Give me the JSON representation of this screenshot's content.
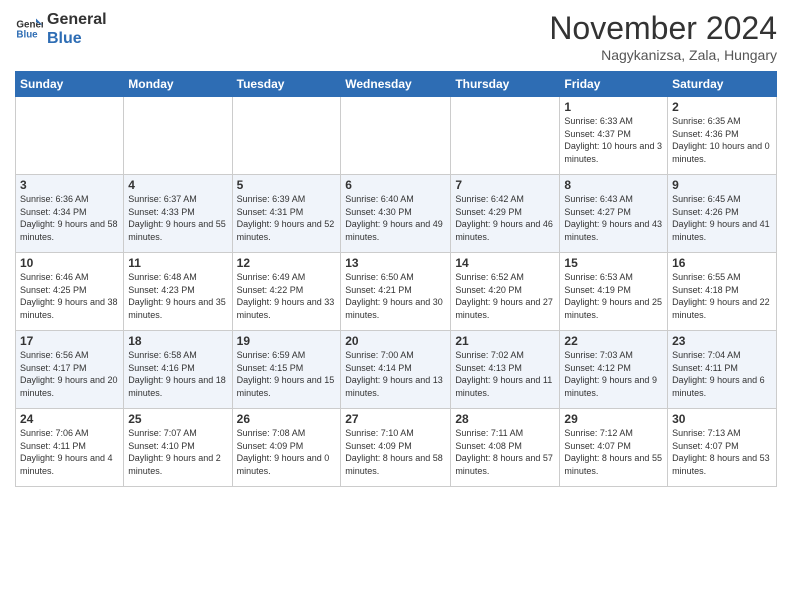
{
  "logo": {
    "line1": "General",
    "line2": "Blue"
  },
  "title": "November 2024",
  "location": "Nagykanizsa, Zala, Hungary",
  "headers": [
    "Sunday",
    "Monday",
    "Tuesday",
    "Wednesday",
    "Thursday",
    "Friday",
    "Saturday"
  ],
  "weeks": [
    [
      {
        "day": "",
        "info": ""
      },
      {
        "day": "",
        "info": ""
      },
      {
        "day": "",
        "info": ""
      },
      {
        "day": "",
        "info": ""
      },
      {
        "day": "",
        "info": ""
      },
      {
        "day": "1",
        "info": "Sunrise: 6:33 AM\nSunset: 4:37 PM\nDaylight: 10 hours and 3 minutes."
      },
      {
        "day": "2",
        "info": "Sunrise: 6:35 AM\nSunset: 4:36 PM\nDaylight: 10 hours and 0 minutes."
      }
    ],
    [
      {
        "day": "3",
        "info": "Sunrise: 6:36 AM\nSunset: 4:34 PM\nDaylight: 9 hours and 58 minutes."
      },
      {
        "day": "4",
        "info": "Sunrise: 6:37 AM\nSunset: 4:33 PM\nDaylight: 9 hours and 55 minutes."
      },
      {
        "day": "5",
        "info": "Sunrise: 6:39 AM\nSunset: 4:31 PM\nDaylight: 9 hours and 52 minutes."
      },
      {
        "day": "6",
        "info": "Sunrise: 6:40 AM\nSunset: 4:30 PM\nDaylight: 9 hours and 49 minutes."
      },
      {
        "day": "7",
        "info": "Sunrise: 6:42 AM\nSunset: 4:29 PM\nDaylight: 9 hours and 46 minutes."
      },
      {
        "day": "8",
        "info": "Sunrise: 6:43 AM\nSunset: 4:27 PM\nDaylight: 9 hours and 43 minutes."
      },
      {
        "day": "9",
        "info": "Sunrise: 6:45 AM\nSunset: 4:26 PM\nDaylight: 9 hours and 41 minutes."
      }
    ],
    [
      {
        "day": "10",
        "info": "Sunrise: 6:46 AM\nSunset: 4:25 PM\nDaylight: 9 hours and 38 minutes."
      },
      {
        "day": "11",
        "info": "Sunrise: 6:48 AM\nSunset: 4:23 PM\nDaylight: 9 hours and 35 minutes."
      },
      {
        "day": "12",
        "info": "Sunrise: 6:49 AM\nSunset: 4:22 PM\nDaylight: 9 hours and 33 minutes."
      },
      {
        "day": "13",
        "info": "Sunrise: 6:50 AM\nSunset: 4:21 PM\nDaylight: 9 hours and 30 minutes."
      },
      {
        "day": "14",
        "info": "Sunrise: 6:52 AM\nSunset: 4:20 PM\nDaylight: 9 hours and 27 minutes."
      },
      {
        "day": "15",
        "info": "Sunrise: 6:53 AM\nSunset: 4:19 PM\nDaylight: 9 hours and 25 minutes."
      },
      {
        "day": "16",
        "info": "Sunrise: 6:55 AM\nSunset: 4:18 PM\nDaylight: 9 hours and 22 minutes."
      }
    ],
    [
      {
        "day": "17",
        "info": "Sunrise: 6:56 AM\nSunset: 4:17 PM\nDaylight: 9 hours and 20 minutes."
      },
      {
        "day": "18",
        "info": "Sunrise: 6:58 AM\nSunset: 4:16 PM\nDaylight: 9 hours and 18 minutes."
      },
      {
        "day": "19",
        "info": "Sunrise: 6:59 AM\nSunset: 4:15 PM\nDaylight: 9 hours and 15 minutes."
      },
      {
        "day": "20",
        "info": "Sunrise: 7:00 AM\nSunset: 4:14 PM\nDaylight: 9 hours and 13 minutes."
      },
      {
        "day": "21",
        "info": "Sunrise: 7:02 AM\nSunset: 4:13 PM\nDaylight: 9 hours and 11 minutes."
      },
      {
        "day": "22",
        "info": "Sunrise: 7:03 AM\nSunset: 4:12 PM\nDaylight: 9 hours and 9 minutes."
      },
      {
        "day": "23",
        "info": "Sunrise: 7:04 AM\nSunset: 4:11 PM\nDaylight: 9 hours and 6 minutes."
      }
    ],
    [
      {
        "day": "24",
        "info": "Sunrise: 7:06 AM\nSunset: 4:11 PM\nDaylight: 9 hours and 4 minutes."
      },
      {
        "day": "25",
        "info": "Sunrise: 7:07 AM\nSunset: 4:10 PM\nDaylight: 9 hours and 2 minutes."
      },
      {
        "day": "26",
        "info": "Sunrise: 7:08 AM\nSunset: 4:09 PM\nDaylight: 9 hours and 0 minutes."
      },
      {
        "day": "27",
        "info": "Sunrise: 7:10 AM\nSunset: 4:09 PM\nDaylight: 8 hours and 58 minutes."
      },
      {
        "day": "28",
        "info": "Sunrise: 7:11 AM\nSunset: 4:08 PM\nDaylight: 8 hours and 57 minutes."
      },
      {
        "day": "29",
        "info": "Sunrise: 7:12 AM\nSunset: 4:07 PM\nDaylight: 8 hours and 55 minutes."
      },
      {
        "day": "30",
        "info": "Sunrise: 7:13 AM\nSunset: 4:07 PM\nDaylight: 8 hours and 53 minutes."
      }
    ]
  ]
}
